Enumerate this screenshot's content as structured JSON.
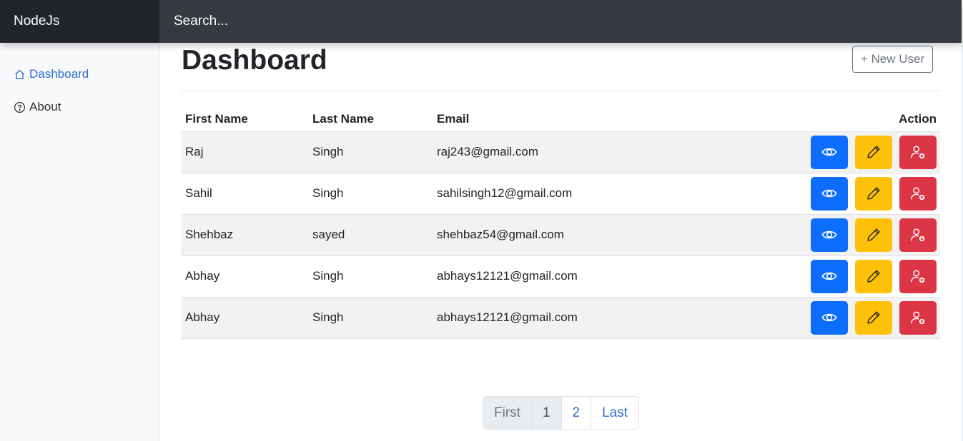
{
  "navbar": {
    "brand": "NodeJs",
    "search_placeholder": "Search..."
  },
  "sidebar": {
    "items": [
      {
        "label": "Dashboard",
        "icon": "house-icon",
        "active": true
      },
      {
        "label": "About",
        "icon": "question-circle-icon",
        "active": false
      }
    ]
  },
  "main": {
    "title": "Dashboard",
    "new_user_label": "+ New User",
    "table": {
      "headers": {
        "first": "First Name",
        "last": "Last Name",
        "email": "Email",
        "action": "Action"
      },
      "rows": [
        {
          "first": "Raj",
          "last": "Singh",
          "email": "raj243@gmail.com"
        },
        {
          "first": "Sahil",
          "last": "Singh",
          "email": "sahilsingh12@gmail.com"
        },
        {
          "first": "Shehbaz",
          "last": "sayed",
          "email": "shehbaz54@gmail.com"
        },
        {
          "first": "Abhay",
          "last": "Singh",
          "email": "abhays12121@gmail.com"
        },
        {
          "first": "Abhay",
          "last": "Singh",
          "email": "abhays12121@gmail.com"
        }
      ]
    },
    "pagination": {
      "first": "First",
      "pages": [
        "1",
        "2"
      ],
      "last": "Last",
      "current": "1"
    }
  },
  "colors": {
    "view": "#0d6efd",
    "edit": "#ffc107",
    "delete": "#dc3545",
    "link": "#2c6ecb",
    "navbar": "#343a40",
    "brand_bg": "#212529"
  }
}
